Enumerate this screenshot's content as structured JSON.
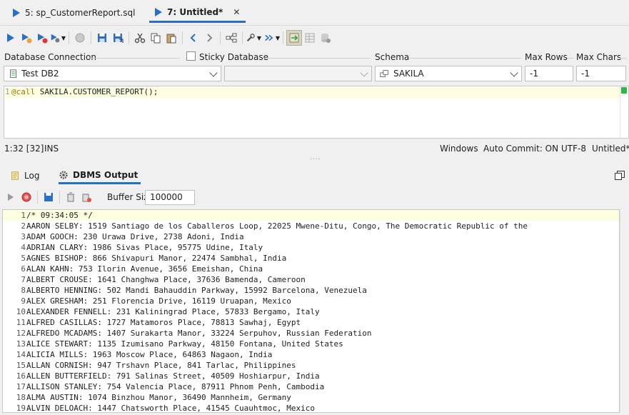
{
  "tabs": [
    {
      "label": "5: sp_CustomerReport.sql"
    },
    {
      "label": "7: Untitled*"
    }
  ],
  "labels": {
    "db_connection": "Database Connection",
    "sticky": "Sticky Database",
    "schema": "Schema",
    "max_rows": "Max Rows",
    "max_chars": "Max Chars"
  },
  "fields": {
    "connection": "Test DB2",
    "database": "",
    "schema": "SAKILA",
    "max_rows": "-1",
    "max_chars": "-1"
  },
  "editor": {
    "line_no": "1",
    "keyword": "@call",
    "rest": " SAKILA.CUSTOMER_REPORT();"
  },
  "status": {
    "position": "1:32 [32]",
    "mode": "INS",
    "line_ending": "Windows",
    "auto_commit": "Auto Commit: ON",
    "encoding": "UTF-8",
    "file": "Untitled*"
  },
  "bottom_tabs": {
    "log": "Log",
    "dbms": "DBMS Output"
  },
  "buffer": {
    "label": "Buffer Size:",
    "value": "100000"
  },
  "output": [
    "/* 09:34:05 */",
    "AARON SELBY: 1519 Santiago de los Caballeros Loop, 22025 Mwene-Ditu, Congo, The Democratic Republic of the",
    "ADAM GOOCH: 230 Urawa Drive, 2738 Adoni, India",
    "ADRIAN CLARY: 1986 Sivas Place, 95775 Udine, Italy",
    "AGNES BISHOP: 866 Shivapuri Manor, 22474 Sambhal, India",
    "ALAN KAHN: 753 Ilorin Avenue, 3656 Emeishan, China",
    "ALBERT CROUSE: 1641 Changhwa Place, 37636 Bamenda, Cameroon",
    "ALBERTO HENNING: 502 Mandi Bahauddin Parkway, 15992 Barcelona, Venezuela",
    "ALEX GRESHAM: 251 Florencia Drive, 16119 Uruapan, Mexico",
    "ALEXANDER FENNELL: 231 Kaliningrad Place, 57833 Bergamo, Italy",
    "ALFRED CASILLAS: 1727 Matamoros Place, 78813 Sawhaj, Egypt",
    "ALFREDO MCADAMS: 1407 Surakarta Manor, 33224 Serpuhov, Russian Federation",
    "ALICE STEWART: 1135 Izumisano Parkway, 48150 Fontana, United States",
    "ALICIA MILLS: 1963 Moscow Place, 64863 Nagaon, India",
    "ALLAN CORNISH: 947 Trshavn Place, 841 Tarlac, Philippines",
    "ALLEN BUTTERFIELD: 791 Salinas Street, 40509 Hoshiarpur, India",
    "ALLISON STANLEY: 754 Valencia Place, 87911 Phnom Penh, Cambodia",
    "ALMA AUSTIN: 1074 Binzhou Manor, 36490 Mannheim, Germany",
    "ALVIN DELOACH: 1447 Chatsworth Place, 41545 Cuauhtmoc, Mexico"
  ]
}
